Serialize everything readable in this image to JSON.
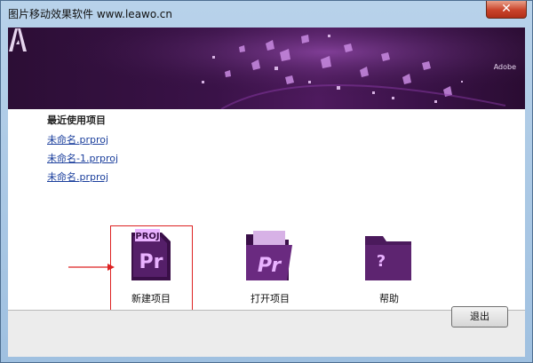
{
  "window": {
    "title": "图片移动效果软件 www.leawo.cn",
    "close_label": "✕"
  },
  "banner": {
    "brand_text": "Adobe",
    "logo_icon": "adobe-logo-icon"
  },
  "recent": {
    "heading": "最近使用项目",
    "items": [
      "未命名.prproj",
      "未命名-1.prproj",
      "未命名.prproj"
    ]
  },
  "actions": [
    {
      "label": "新建项目",
      "icon": "new-project-icon",
      "icon_text": "Pr",
      "tab_text": "PROJ"
    },
    {
      "label": "打开项目",
      "icon": "open-folder-icon",
      "icon_text": "Pr"
    },
    {
      "label": "帮助",
      "icon": "help-folder-icon",
      "icon_text": "?"
    }
  ],
  "footer": {
    "exit_label": "退出"
  },
  "colors": {
    "premiere_purple": "#4b1a5c",
    "premiere_accent": "#e9b2ff",
    "highlight_red": "#dd2222",
    "link_blue": "#1a3e9c"
  }
}
